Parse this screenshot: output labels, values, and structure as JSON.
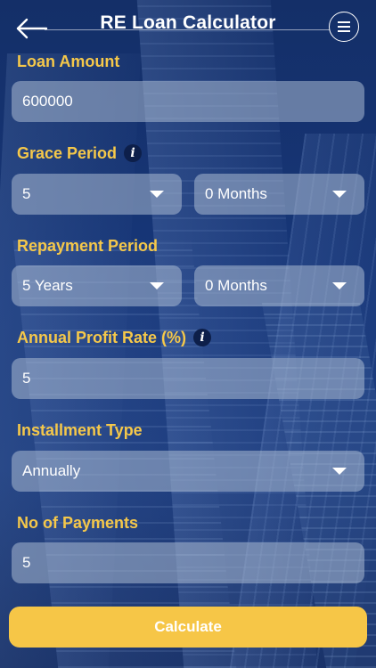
{
  "header": {
    "title": "RE Loan Calculator",
    "back_icon": "arrow-left-icon",
    "menu_icon": "menu-lines-icon"
  },
  "loan_amount": {
    "label": "Loan Amount",
    "value": "600000"
  },
  "grace_period": {
    "label": "Grace Period",
    "years_value": "5",
    "months_value": "0 Months"
  },
  "repayment_period": {
    "label": "Repayment Period",
    "years_value": "5 Years",
    "months_value": "0 Months"
  },
  "annual_profit_rate": {
    "label": "Annual Profit Rate (%)",
    "value": "5"
  },
  "installment_type": {
    "label": "Installment Type",
    "value": "Annually"
  },
  "no_of_payments": {
    "label": "No of Payments",
    "value": "5"
  },
  "info_glyph": "i",
  "calculate_label": "Calculate",
  "colors": {
    "accent_label": "#f5c84a",
    "button": "#f6c647",
    "background": "#13306b"
  }
}
